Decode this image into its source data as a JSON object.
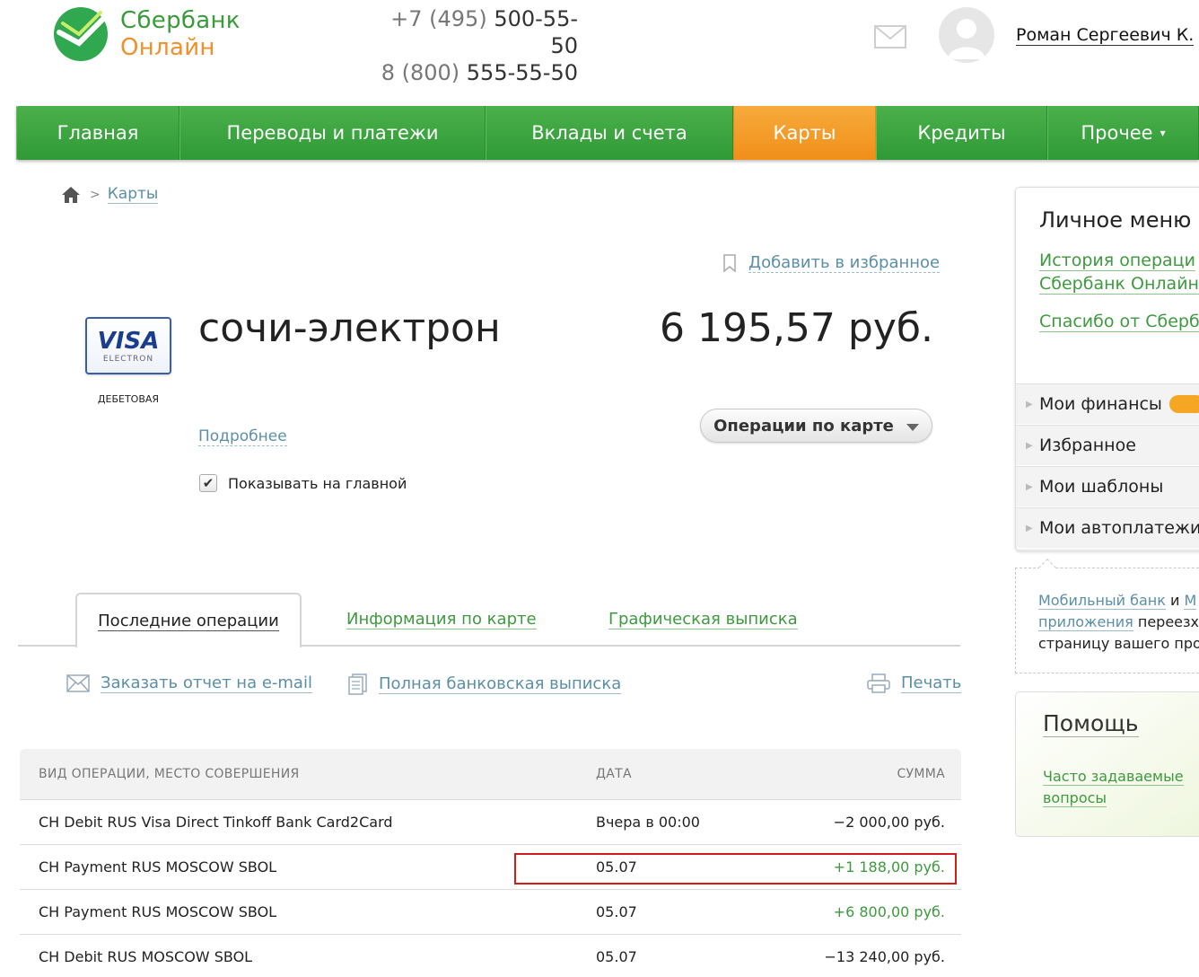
{
  "logo": {
    "line1": "Сбербанк",
    "line2": "Онлайн"
  },
  "phones": [
    {
      "code": "+7 (495)",
      "number": "500-55-50"
    },
    {
      "code": "8 (800)",
      "number": "555-55-50"
    }
  ],
  "user": {
    "name": "Роман Сергеевич К."
  },
  "nav": [
    {
      "label": "Главная"
    },
    {
      "label": "Переводы и платежи"
    },
    {
      "label": "Вклады и счета"
    },
    {
      "label": "Карты",
      "active": true
    },
    {
      "label": "Кредиты"
    },
    {
      "label": "Прочее"
    }
  ],
  "nav_more_caret": "▾",
  "breadcrumb": {
    "current": "Карты"
  },
  "favorites_label": "Добавить в избранное",
  "card": {
    "logo_main": "VISA",
    "logo_sub": "ELECTRON",
    "kind": "ДЕБЕТОВАЯ",
    "name": "сочи-электрон",
    "balance": "6 195,57 руб.",
    "details_link": "Подробнее",
    "operations_button": "Операции по карте",
    "show_on_main_label": "Показывать на главной",
    "show_on_main_checked": true
  },
  "tabs": [
    {
      "label": "Последние операции",
      "active": true
    },
    {
      "label": "Информация по карте"
    },
    {
      "label": "Графическая выписка"
    }
  ],
  "actions": {
    "email_report": "Заказать отчет на e-mail",
    "full_statement": "Полная банковская выписка",
    "print": "Печать"
  },
  "table": {
    "headers": [
      "ВИД ОПЕРАЦИИ, МЕСТО СОВЕРШЕНИЯ",
      "ДАТА",
      "СУММА"
    ],
    "rows": [
      {
        "desc": "CH Debit RUS Visa Direct Tinkoff Bank Card2Card",
        "date": "Вчера в 00:00",
        "amount": "−2 000,00 руб.",
        "positive": false
      },
      {
        "desc": "CH Payment RUS MOSCOW SBOL",
        "date": "05.07",
        "amount": "+1 188,00 руб.",
        "positive": true
      },
      {
        "desc": "CH Payment RUS MOSCOW SBOL",
        "date": "05.07",
        "amount": "+6 800,00 руб.",
        "positive": true
      },
      {
        "desc": "CH Debit RUS MOSCOW SBOL",
        "date": "05.07",
        "amount": "−13 240,00 руб.",
        "positive": false
      }
    ]
  },
  "sidebar": {
    "title": "Личное меню",
    "links": [
      "История операци",
      "Сбербанк Онлайн",
      "Спасибо от Сберб"
    ],
    "items": [
      "Мои финансы",
      "Избранное",
      "Мои шаблоны",
      "Мои автоплатежи"
    ],
    "mobile": {
      "link1": "Мобильный банк",
      "and": "и",
      "link2": "М",
      "link3": "приложения",
      "text1": "переезха",
      "text2": "страницу вашего про"
    },
    "help": {
      "title": "Помощь",
      "faq_line1": "Часто задаваемые",
      "faq_line2": "вопросы"
    }
  },
  "colors": {
    "brand_green": "#3a9b3a",
    "active_tab_orange": "#f59d2a",
    "link_blue": "#5b8fa8",
    "positive_green": "#3e9a3e",
    "highlight_red": "#d01c1c"
  }
}
